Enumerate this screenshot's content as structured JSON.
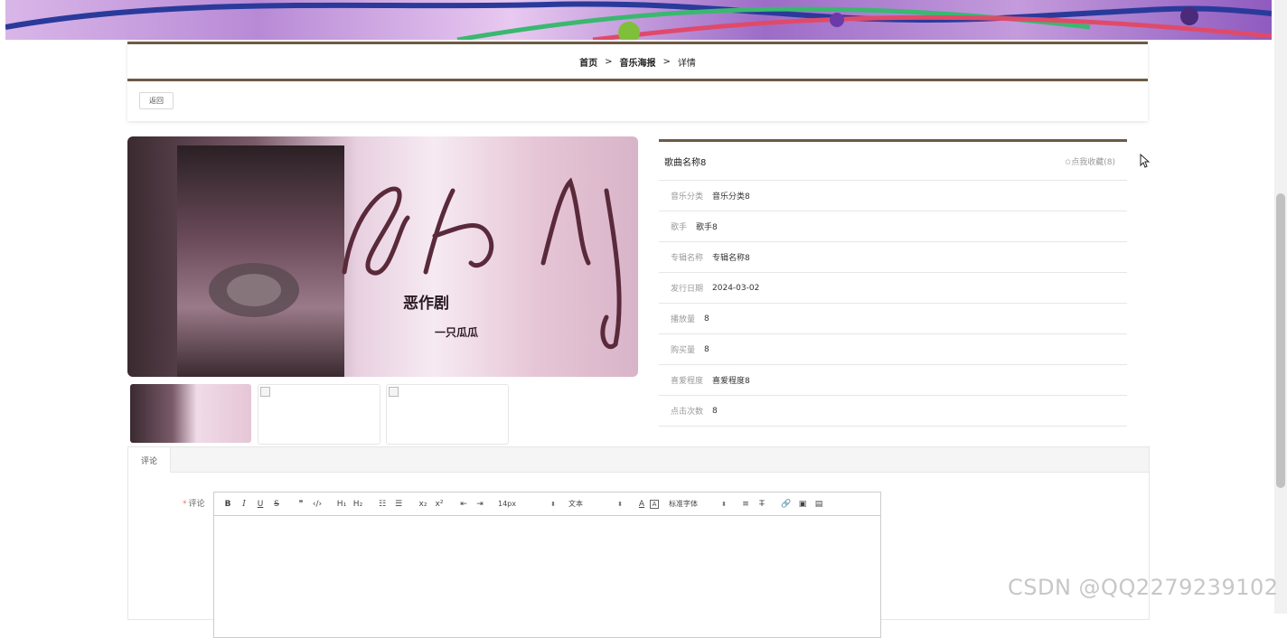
{
  "breadcrumb": {
    "home": "首页",
    "section": "音乐海报",
    "current": "详情",
    "separator": ">"
  },
  "back_button": "返回",
  "album_art": {
    "title_text": "恶作剧",
    "artist_text": "一只瓜瓜"
  },
  "detail": {
    "song_name": "歌曲名称8",
    "favorite": "✩点我收藏(8)",
    "rows": [
      {
        "label": "音乐分类",
        "value": "音乐分类8"
      },
      {
        "label": "歌手",
        "value": "歌手8"
      },
      {
        "label": "专辑名称",
        "value": "专辑名称8"
      },
      {
        "label": "发行日期",
        "value": "2024-03-02"
      },
      {
        "label": "播放量",
        "value": "8"
      },
      {
        "label": "购买量",
        "value": "8"
      },
      {
        "label": "喜爱程度",
        "value": "喜爱程度8"
      },
      {
        "label": "点击次数",
        "value": "8"
      }
    ]
  },
  "comments": {
    "tab": "评论",
    "required_mark": "*",
    "label": "评论",
    "toolbar": {
      "bold": "B",
      "italic": "I",
      "underline": "U",
      "strike": "S",
      "quote": "❞",
      "code": "‹/›",
      "h1": "H₁",
      "h2": "H₂",
      "ordered_list": "☷",
      "bullet_list": "☰",
      "sub": "x₂",
      "sup": "x²",
      "outdent": "⇤",
      "indent": "⇥",
      "size": "14px",
      "format": "文本",
      "font": "标准字体",
      "color": "A",
      "background": "A",
      "align": "≡",
      "clear": "T̶",
      "link": "🔗",
      "image": "▣",
      "video": "▤",
      "dropdown_arrow": "⬍"
    }
  },
  "watermark": "CSDN @QQ2279239102"
}
